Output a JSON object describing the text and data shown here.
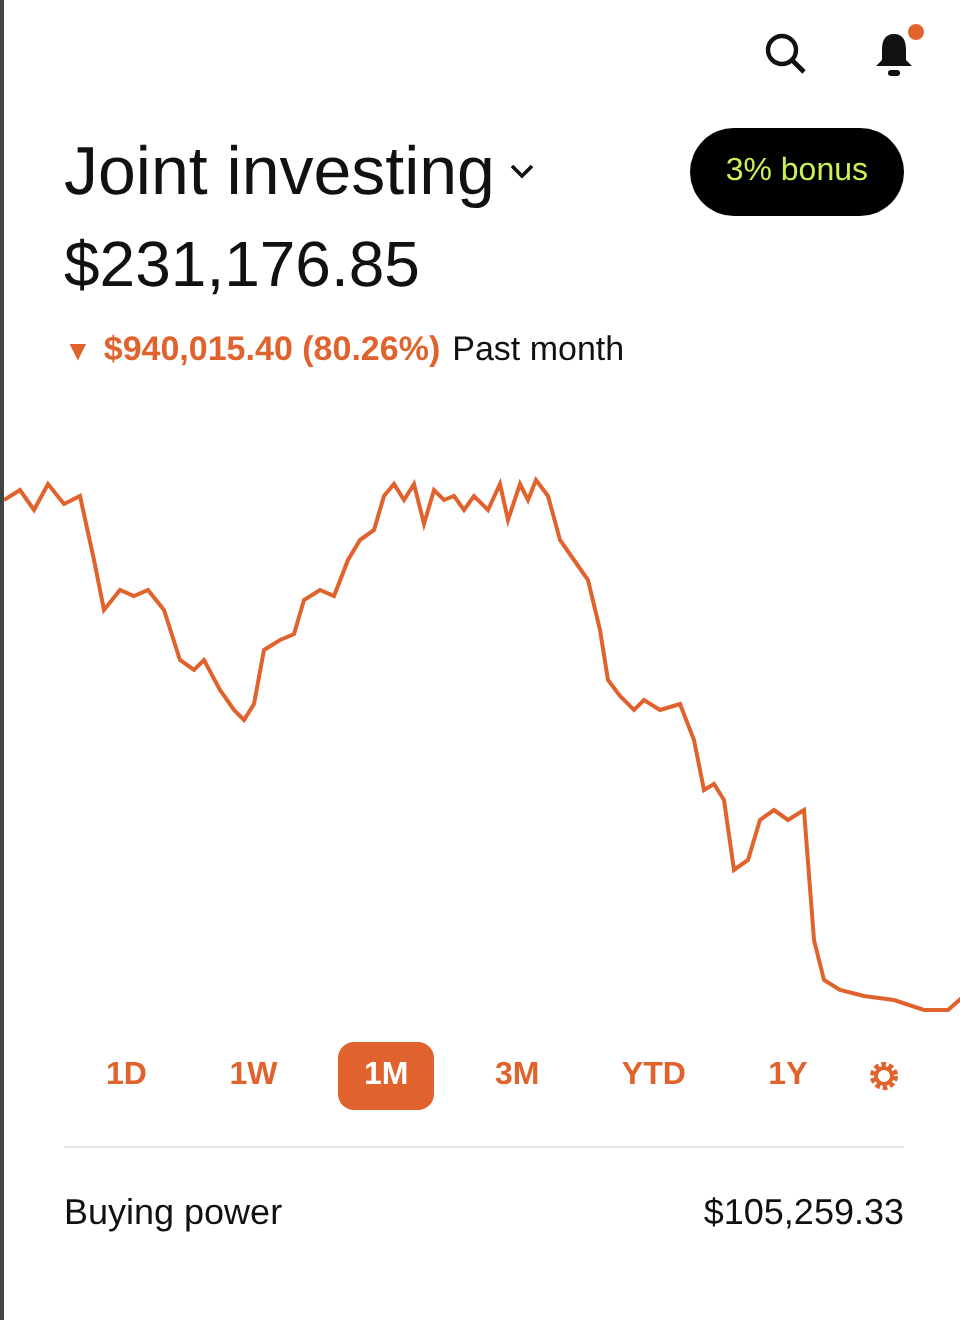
{
  "header": {
    "account": "Joint investing",
    "bonus": "3% bonus",
    "notification_dot": true
  },
  "balance": "$231,176.85",
  "change": {
    "arrow": "▼",
    "amount": "$940,015.40 (80.26%)",
    "period": "Past month"
  },
  "ranges": [
    {
      "label": "1D",
      "selected": false
    },
    {
      "label": "1W",
      "selected": false
    },
    {
      "label": "1M",
      "selected": true
    },
    {
      "label": "3M",
      "selected": false
    },
    {
      "label": "YTD",
      "selected": false
    },
    {
      "label": "1Y",
      "selected": false
    }
  ],
  "buying_power": {
    "label": "Buying power",
    "value": "$105,259.33"
  }
}
